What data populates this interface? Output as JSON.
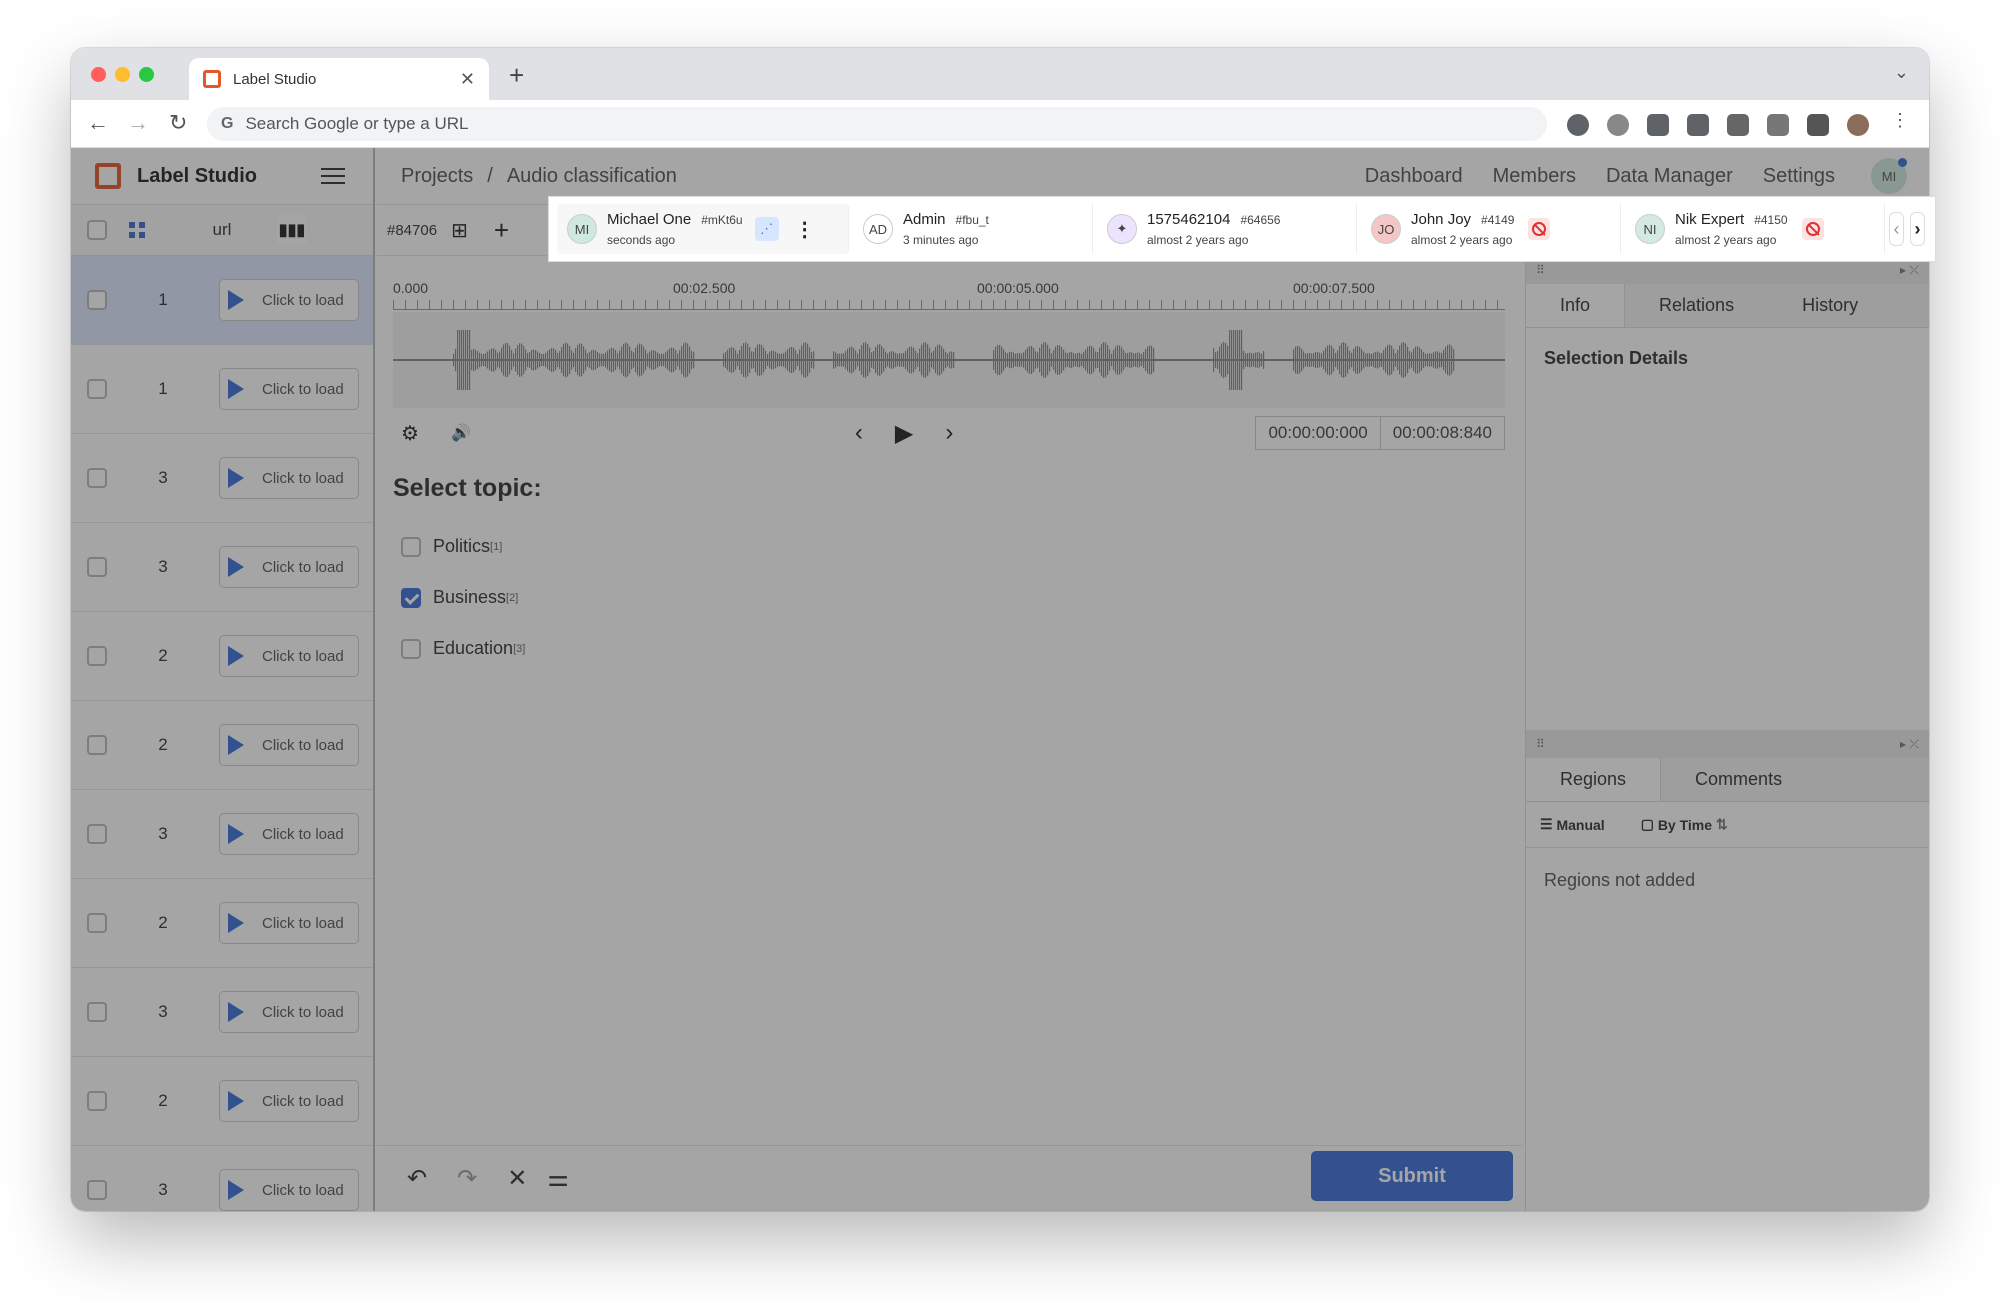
{
  "browser": {
    "tab_title": "Label Studio",
    "omnibox_placeholder": "Search Google or type a URL"
  },
  "app": {
    "name": "Label Studio",
    "breadcrumb": {
      "projects": "Projects",
      "separator": "/",
      "project": "Audio classification"
    },
    "nav": [
      "Dashboard",
      "Members",
      "Data Manager",
      "Settings"
    ],
    "user_initials": "MI"
  },
  "grid": {
    "column_label": "url",
    "load_label": "Click to load",
    "rows": [
      {
        "value": "1",
        "selected": true
      },
      {
        "value": "1",
        "selected": false
      },
      {
        "value": "3",
        "selected": false
      },
      {
        "value": "3",
        "selected": false
      },
      {
        "value": "2",
        "selected": false
      },
      {
        "value": "2",
        "selected": false
      },
      {
        "value": "3",
        "selected": false
      },
      {
        "value": "2",
        "selected": false
      },
      {
        "value": "3",
        "selected": false
      },
      {
        "value": "2",
        "selected": false
      },
      {
        "value": "3",
        "selected": false
      }
    ]
  },
  "task": {
    "id": "#84706"
  },
  "annotations": [
    {
      "initials": "MI",
      "name": "Michael One",
      "id": "#mKt6u",
      "time": "seconds ago",
      "current": true,
      "avatar_color": "#cfe9e0"
    },
    {
      "initials": "AD",
      "name": "Admin",
      "id": "#fbu_t",
      "time": "3 minutes ago",
      "current": false,
      "avatar_color": "#ffffff"
    },
    {
      "initials": "✦",
      "name": "1575462104",
      "id": "#64656",
      "time": "almost 2 years ago",
      "current": false,
      "avatar_color": "#ece4ff"
    },
    {
      "initials": "JO",
      "name": "John Joy",
      "id": "#4149",
      "time": "almost 2 years ago",
      "current": false,
      "avatar_color": "#f4c7c7",
      "banned": true
    },
    {
      "initials": "NI",
      "name": "Nik Expert",
      "id": "#4150",
      "time": "almost 2 years ago",
      "current": false,
      "avatar_color": "#d3e9e2",
      "banned": true
    }
  ],
  "audio": {
    "ticks": [
      "0.000",
      "00:02.500",
      "00:00:05.000",
      "00:00:07.500"
    ],
    "current_time": "00:00:00:000",
    "duration": "00:00:08:840"
  },
  "question": {
    "title": "Select topic:",
    "choices": [
      {
        "label": "Politics",
        "hotkey": "[1]",
        "checked": false
      },
      {
        "label": "Business",
        "hotkey": "[2]",
        "checked": true
      },
      {
        "label": "Education",
        "hotkey": "[3]",
        "checked": false
      }
    ]
  },
  "actions": {
    "submit": "Submit"
  },
  "side_panel": {
    "tabs_top": [
      "Info",
      "Relations",
      "History"
    ],
    "info_title": "Selection Details",
    "tabs_bottom": [
      "Regions",
      "Comments"
    ],
    "sort_manual": "Manual",
    "sort_by_time": "By Time",
    "empty_regions": "Regions not added"
  },
  "colors": {
    "accent": "#3b6fd8",
    "brand": "#e4572e",
    "danger": "#e03131"
  }
}
